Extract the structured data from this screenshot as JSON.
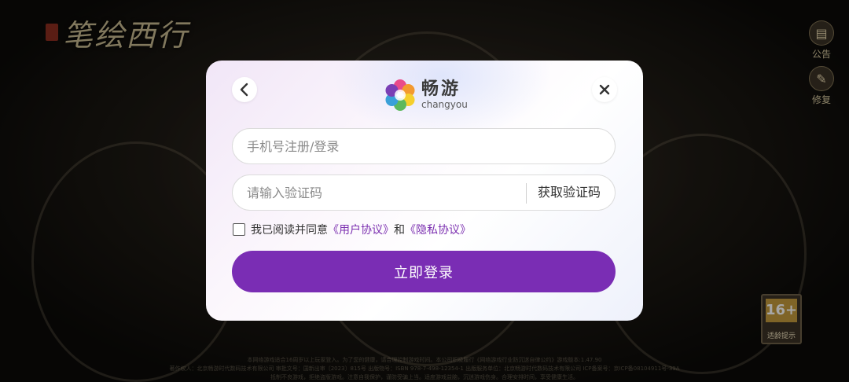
{
  "background": {
    "game_title": "笔绘西行",
    "side_buttons": [
      {
        "label": "公告",
        "icon": "notice-icon"
      },
      {
        "label": "修复",
        "icon": "repair-icon"
      }
    ],
    "age_rating": {
      "value": "16+",
      "label": "适龄提示"
    },
    "footer_lines": [
      "本网络游戏适合16周岁以上玩家登入。为了您的健康，请合理控制游戏时间。本公司积极履行《网络游戏行业防沉迷自律公约》游戏版本:1.47.90",
      "著作权人：北京畅游时代数码技术有限公司 审批文号：国新出审〔2023〕815号 出版物号：ISBN 978-7-498-12354-1 出版服务单位：北京畅游时代数码技术有限公司 ICP备案号：京ICP备08104911号-39A",
      "抵制不良游戏，拒绝盗版游戏。注意自我保护，谨防受骗上当。适度游戏益脑，沉迷游戏伤身。合理安排时间，享受健康生活。"
    ]
  },
  "modal": {
    "brand": {
      "name_cn": "畅游",
      "name_en": "changyou"
    },
    "back_icon": "chevron-left-icon",
    "close_icon": "close-icon",
    "phone_input": {
      "placeholder": "手机号注册/登录",
      "value": ""
    },
    "code_input": {
      "placeholder": "请输入验证码",
      "value": ""
    },
    "get_code_label": "获取验证码",
    "agreement": {
      "checked": false,
      "prefix": "我已阅读并同意",
      "user_agreement": "《用户协议》",
      "joiner": "和",
      "privacy_policy": "《隐私协议》"
    },
    "login_label": "立即登录",
    "accent_color": "#7a2db4"
  }
}
